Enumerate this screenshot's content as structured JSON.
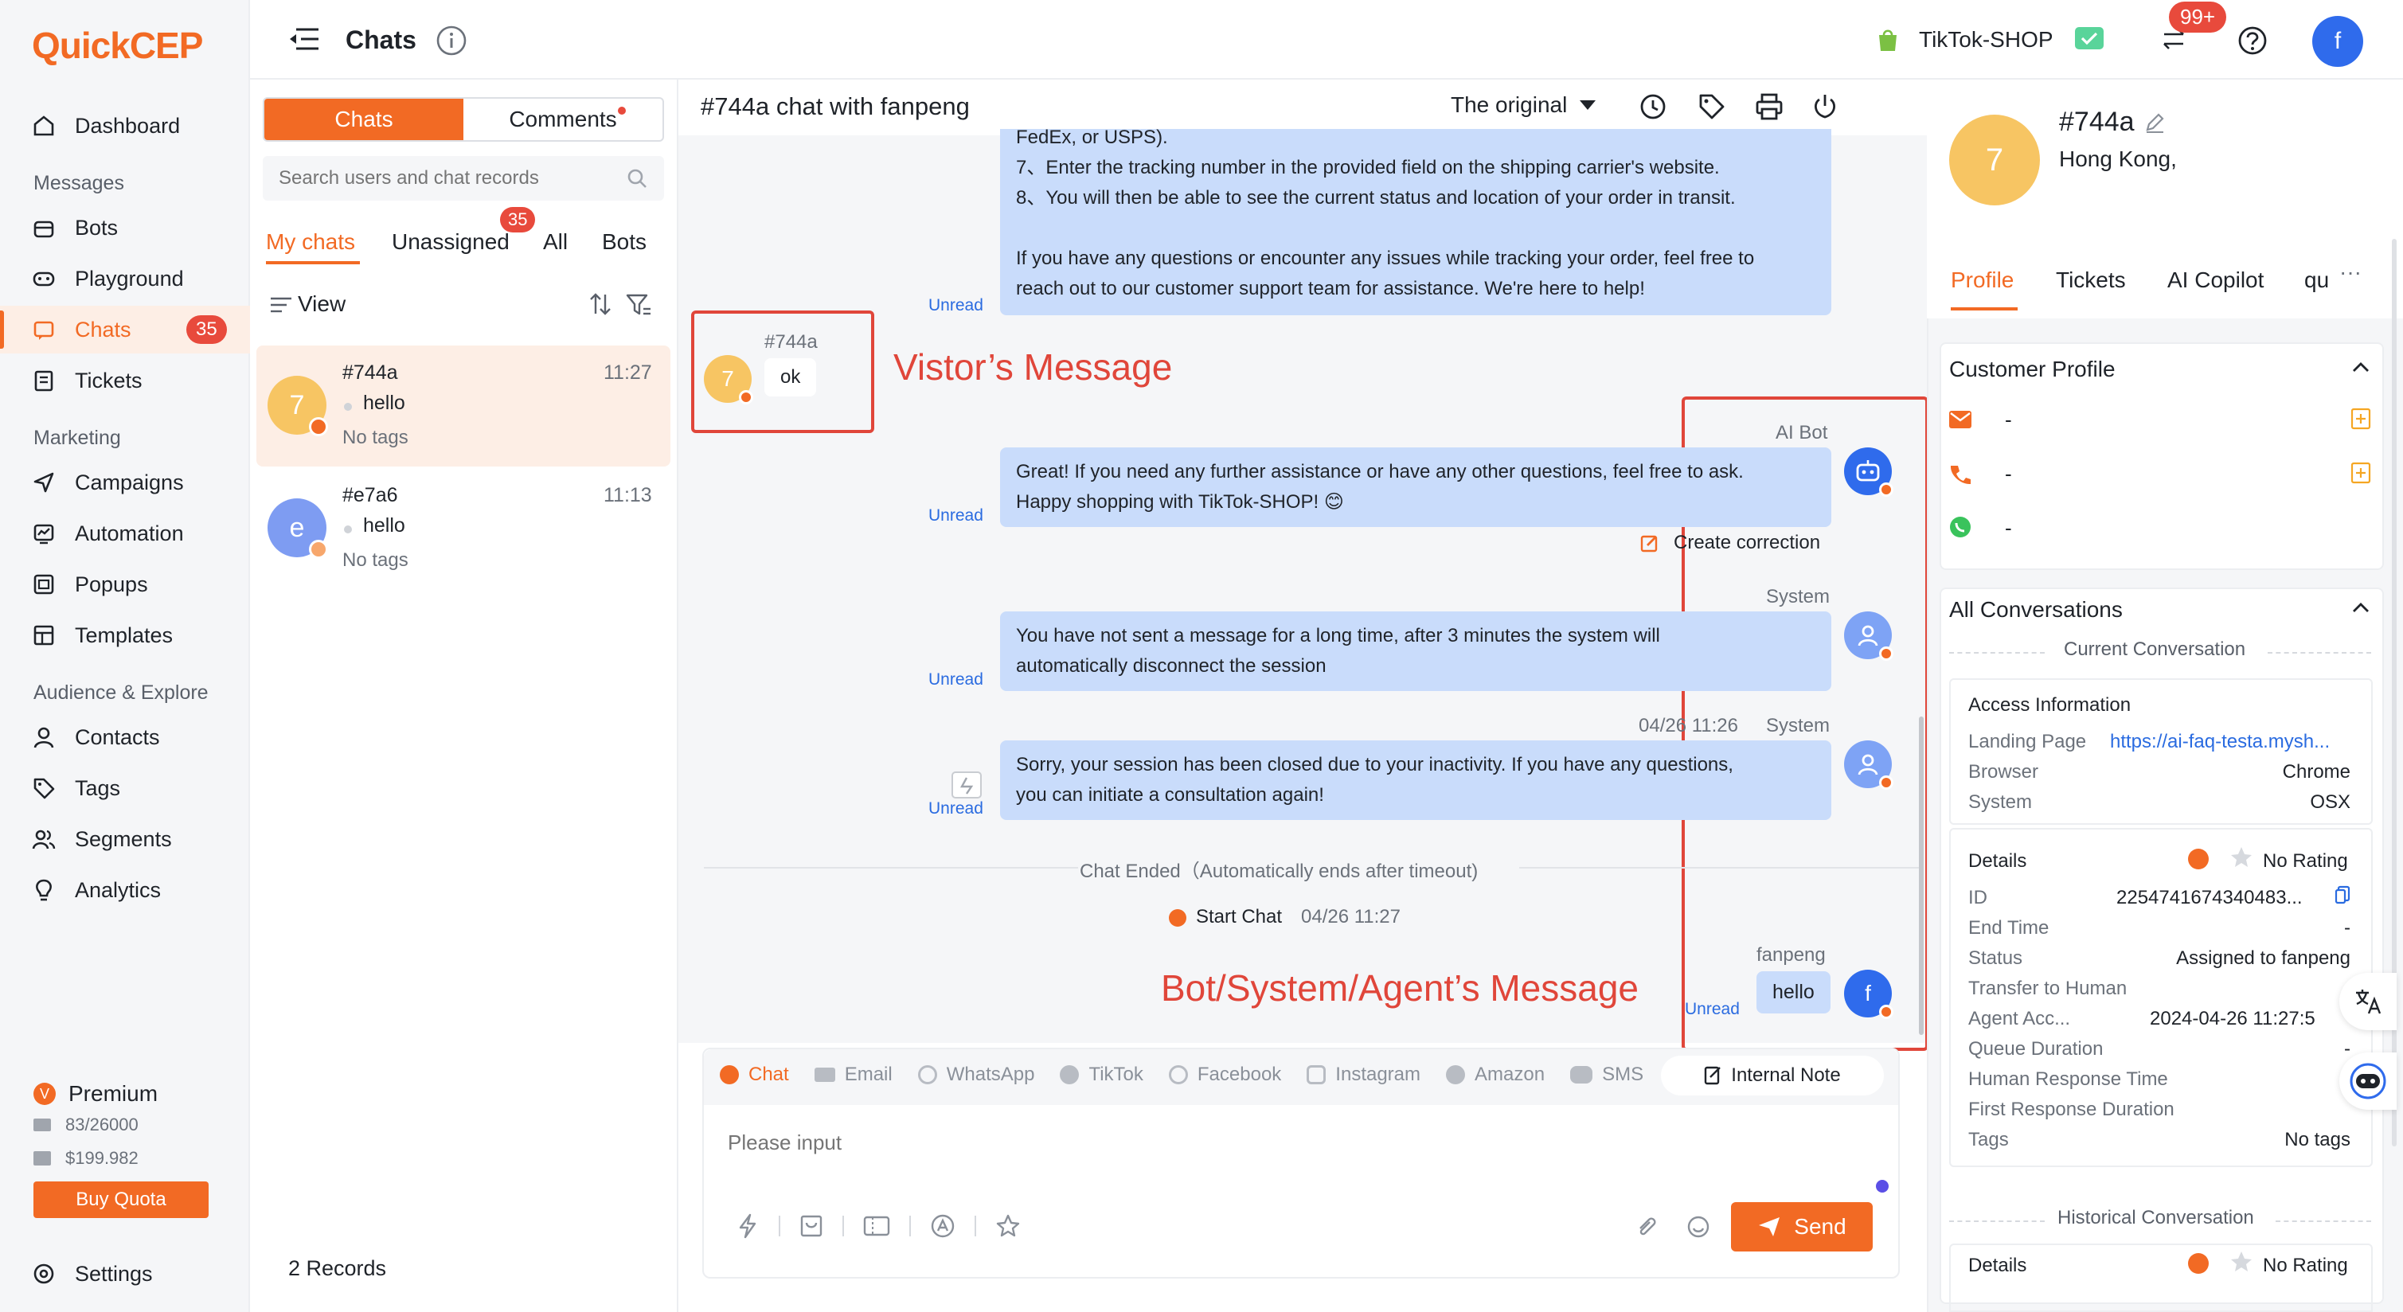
{
  "brand": {
    "logo_text": "QuickCEP"
  },
  "sidebar": {
    "dashboard": "Dashboard",
    "sections": {
      "messages": "Messages",
      "marketing": "Marketing",
      "audience": "Audience & Explore"
    },
    "items": {
      "bots": "Bots",
      "playground": "Playground",
      "chats": "Chats",
      "chats_badge": "35",
      "tickets": "Tickets",
      "campaigns": "Campaigns",
      "automation": "Automation",
      "popups": "Popups",
      "templates": "Templates",
      "contacts": "Contacts",
      "tags": "Tags",
      "segments": "Segments",
      "analytics": "Analytics"
    },
    "plan": {
      "name": "Premium",
      "quota": "83/26000",
      "balance": "$199.982",
      "buy_label": "Buy Quota"
    },
    "settings": "Settings"
  },
  "topbar": {
    "title": "Chats",
    "shop_name": "TikTok-SHOP",
    "notif_badge": "99+",
    "user_initial": "f"
  },
  "chatlist": {
    "tabs": {
      "chats": "Chats",
      "comments": "Comments"
    },
    "search_placeholder": "Search users and chat records",
    "filters": {
      "mine": "My chats",
      "unassigned": "Unassigned",
      "unassigned_badge": "35",
      "all": "All",
      "bots": "Bots"
    },
    "view_label": "View",
    "items": [
      {
        "initial": "7",
        "name": "#744a",
        "time": "11:27",
        "last": "hello",
        "tags": "No tags"
      },
      {
        "initial": "e",
        "name": "#e7a6",
        "time": "11:13",
        "last": "hello",
        "tags": "No tags"
      }
    ],
    "records": "2 Records"
  },
  "conversation": {
    "title": "#744a chat with fanpeng",
    "language": "The original",
    "intro_lines": [
      "FedEx, or USPS).",
      "7、Enter the tracking number in the provided field on the shipping carrier's website.",
      "8、You will then be able to see the current status and location of your order in transit.",
      "",
      "If you have any questions or encounter any issues while tracking your order, feel free to",
      "reach out to our customer support team for assistance. We're here to help!"
    ],
    "unread": "Unread",
    "visitor": {
      "name": "#744a",
      "initial": "7",
      "text": "ok"
    },
    "annot_visitor": "Vistor’s Message",
    "annot_agent": "Bot/System/Agent’s Message",
    "bot": {
      "sender": "AI Bot",
      "lines": [
        "Great! If you need any further assistance or have any other questions, feel free to ask.",
        "Happy shopping with TikTok-SHOP! 😊"
      ],
      "correction": "Create correction"
    },
    "system1": {
      "sender": "System",
      "lines": [
        "You have not sent a message for a long time, after 3 minutes the system will",
        "automatically disconnect the session"
      ]
    },
    "system2": {
      "timestamp": "04/26 11:26",
      "sender": "System",
      "lines": [
        "Sorry, your session has been closed due to your inactivity. If you have any questions,",
        "you can initiate a consultation again!"
      ]
    },
    "chat_ended": "Chat Ended（Automatically ends after timeout)",
    "start_chat": "Start Chat",
    "start_time": "04/26 11:27",
    "agent": {
      "sender": "fanpeng",
      "initial": "f",
      "text": "hello"
    },
    "channels": [
      "Chat",
      "Email",
      "WhatsApp",
      "TikTok",
      "Facebook",
      "Instagram",
      "Amazon",
      "SMS"
    ],
    "internal_note": "Internal Note",
    "input_placeholder": "Please input",
    "send": "Send"
  },
  "profile": {
    "initial": "7",
    "name": "#744a",
    "location": "Hong Kong,",
    "tabs": [
      "Profile",
      "Tickets",
      "AI Copilot",
      "qu"
    ],
    "customer_profile": "Customer Profile",
    "email": "-",
    "phone": "-",
    "whatsapp": "-",
    "all_conversations": "All Conversations",
    "current_conversation": "Current Conversation",
    "access": {
      "title": "Access Information",
      "landing_label": "Landing Page",
      "landing_value": "https://ai-faq-testa.mysh...",
      "browser_label": "Browser",
      "browser_value": "Chrome",
      "system_label": "System",
      "system_value": "OSX"
    },
    "details": {
      "title": "Details",
      "rating": "No Rating",
      "id_label": "ID",
      "id_value": "2254741674340483...",
      "end_label": "End Time",
      "end_value": "-",
      "status_label": "Status",
      "status_value": "Assigned to fanpeng",
      "transfer_label": "Transfer to Human",
      "agent_label": "Agent Acc...",
      "agent_value": "2024-04-26 11:27:5",
      "queue_label": "Queue Duration",
      "queue_value": "-",
      "human_resp_label": "Human Response Time",
      "first_resp_label": "First Response Duration",
      "tags_label": "Tags",
      "tags_value": "No tags"
    },
    "historical": "Historical Conversation",
    "hist_details": "Details",
    "hist_rating": "No Rating"
  },
  "colors": {
    "accent": "#f26a24",
    "bubble": "#c9dcfb",
    "annotation": "#e0463a",
    "link": "#2a6be0"
  }
}
